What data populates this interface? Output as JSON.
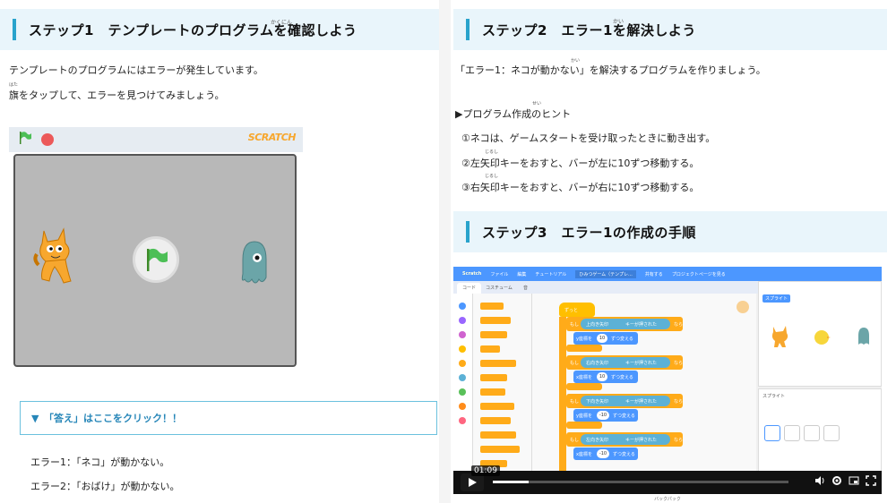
{
  "left": {
    "step1_title": "ステップ1　テンプレートのプログラムを確認しよう",
    "step1_ruby": "かくにん",
    "intro_line1": "テンプレートのプログラムにはエラーが発生しています。",
    "intro_line2": "旗をタップして、エラーを見つけてみましょう。",
    "intro_ruby": "はた",
    "stage_logo": "SCRATCH",
    "answer_toggle": "▼　「答え」はここをクリック！！",
    "error1": "エラー1：「ネコ」が動かない。",
    "error2": "エラー2：「おばけ」が動かない。"
  },
  "right": {
    "step2_title": "ステップ2　エラー1を解決しよう",
    "step2_ruby": "かい",
    "goal_text": "「エラー1：ネコが動かない」を解決するプログラムを作りましょう。",
    "goal_ruby": "かい",
    "hint_heading": "▶プログラム作成のヒント",
    "hint_ruby": "せい",
    "hint1": "①ネコは、ゲームスタートを受け取ったときに動き出す。",
    "hint2": "②左矢印キーをおすと、バーが左に10ずつ移動する。",
    "hint3": "③右矢印キーをおすと、バーが右に10ずつ移動する。",
    "hint_ruby2": "じるし",
    "step3_title": "ステップ3　エラー1の作成の手順"
  },
  "video": {
    "menu_items": [
      "ファイル",
      "編集",
      "チュートリアル",
      "ひみつゲーム（テンプレ...",
      "共有する",
      "プロジェクトページを見る"
    ],
    "tabs": [
      "コード",
      "コスチューム",
      "音"
    ],
    "hat_label": "ずっと",
    "blocks": [
      {
        "cond": "もし",
        "key": "上向き矢印",
        "suffix": "キーが押された",
        "then": "なら",
        "action": "y座標を",
        "value": "10",
        "unit": "ずつ変える"
      },
      {
        "cond": "もし",
        "key": "右向き矢印",
        "suffix": "キーが押された",
        "then": "なら",
        "action": "x座標を",
        "value": "10",
        "unit": "ずつ変える"
      },
      {
        "cond": "もし",
        "key": "下向き矢印",
        "suffix": "キーが押された",
        "then": "なら",
        "action": "y座標を",
        "value": "-10",
        "unit": "ずつ変える"
      },
      {
        "cond": "もし",
        "key": "左向き矢印",
        "suffix": "キーが押された",
        "then": "なら",
        "action": "x座標を",
        "value": "-10",
        "unit": "ずつ変える"
      }
    ],
    "sprite_label": "スプライト",
    "time": "01:09",
    "progress": 0.12,
    "caption": "バックパック"
  },
  "colors": {
    "accent": "#29a3cc",
    "answer_text": "#2686b8",
    "scratch_blue": "#4c97ff",
    "control_orange": "#ffab19"
  }
}
